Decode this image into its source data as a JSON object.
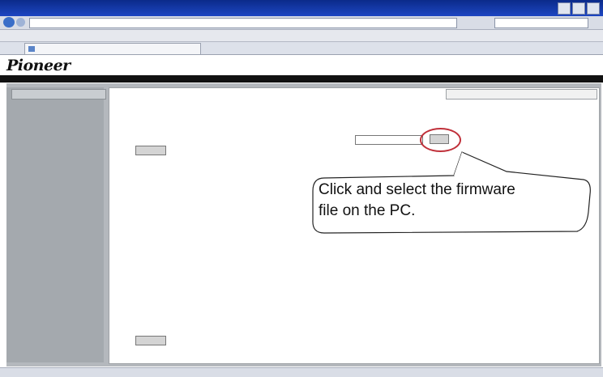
{
  "window": {
    "title": ""
  },
  "browser": {
    "url": "",
    "search_placeholder": "",
    "links_label": "",
    "links": [],
    "tab_title": "",
    "tools": []
  },
  "brand": {
    "logo_text": "Pioneer",
    "band_color": "#111111"
  },
  "sidebar": {
    "tab_label": ""
  },
  "page": {
    "heading": "",
    "version_label": "",
    "version_value": "",
    "date_label": "",
    "date_value": "",
    "select_label": "",
    "file_value": "",
    "browse_label": "",
    "upload_label": "",
    "restart_label": "",
    "restart_button": ""
  },
  "callout": {
    "lines": [
      "Click and select the firmware",
      "file on the PC."
    ],
    "ring_color": "#c0303a"
  }
}
